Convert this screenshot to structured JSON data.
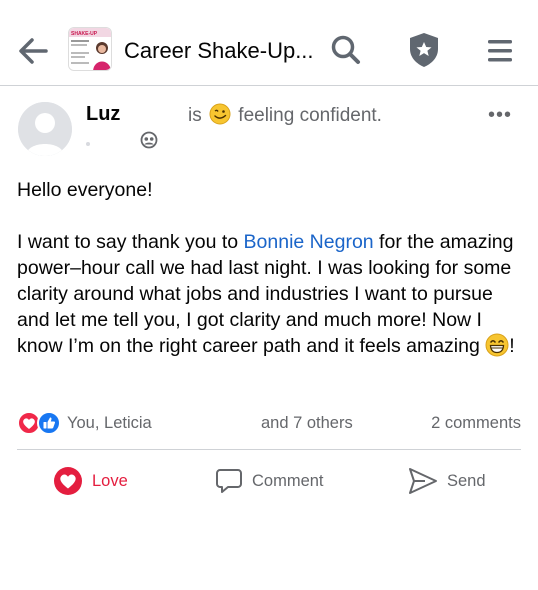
{
  "header": {
    "title": "Career Shake‑Up...",
    "thumb_text": "SHAKE-UP"
  },
  "post": {
    "author": "Luz",
    "feeling_prefix": "is",
    "feeling_text": "feeling confident.",
    "greeting": "Hello everyone!",
    "body_before_mention": "I want to say thank you to ",
    "mention": "Bonnie Negron",
    "body_after_mention": " for the amazing power–hour call we had last night. I was looking for some clarity around what jobs and industries I want to pursue and let me tell you, I got clarity and much more! Now I know I’m on the right career path and it feels amazing ",
    "body_end": "!"
  },
  "stats": {
    "names": "You, Leticia",
    "others": "and 7 others",
    "comments": "2 comments"
  },
  "actions": {
    "love": "Love",
    "comment": "Comment",
    "send": "Send"
  },
  "colors": {
    "love": "#e41e3f",
    "mention": "#1b65c9",
    "like": "#1877f2",
    "muted": "#65676b"
  },
  "icons": [
    "back-arrow-icon",
    "search-icon",
    "shield-star-icon",
    "hamburger-menu-icon",
    "more-options-icon",
    "audience-icon",
    "heart-icon",
    "comment-icon",
    "send-icon",
    "like-icon"
  ]
}
